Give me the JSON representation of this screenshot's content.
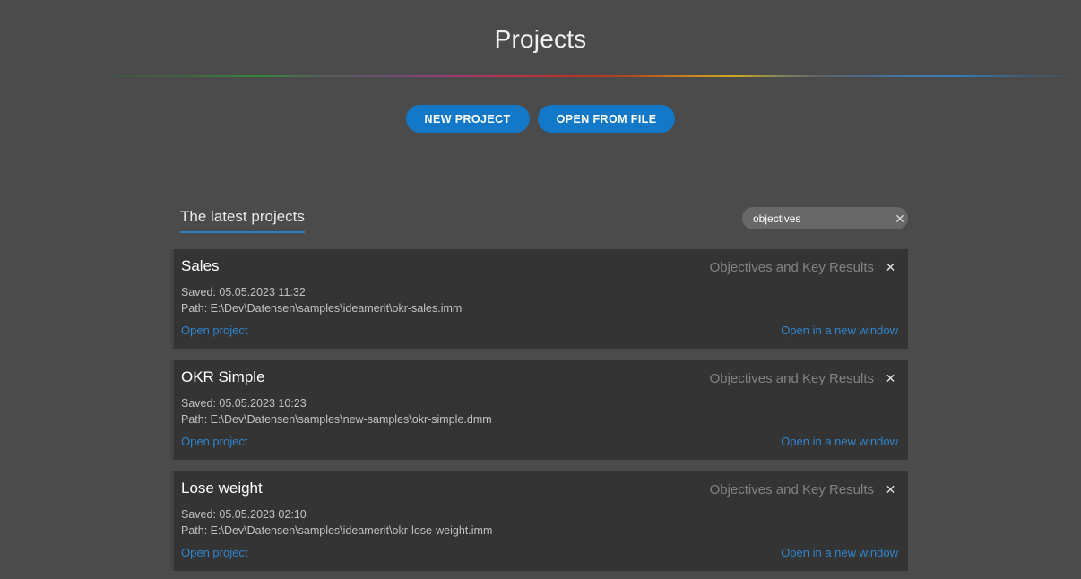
{
  "header": {
    "title": "Projects",
    "divider": "rainbow-gradient-divider"
  },
  "actions": {
    "new_project_label": "NEW PROJECT",
    "open_from_file_label": "OPEN FROM FILE",
    "button_color": "#1478c8"
  },
  "section": {
    "title": "The latest projects",
    "underline_color": "#2f7fc0"
  },
  "search": {
    "value": "objectives",
    "placeholder": "",
    "clear_icon": "close-icon",
    "clear_glyph": "✕"
  },
  "labels": {
    "open_project": "Open project",
    "open_in_new_window": "Open in a new window",
    "close_glyph": "✕",
    "saved_prefix": "Saved: ",
    "path_prefix": "Path: "
  },
  "projects": [
    {
      "name": "Sales",
      "type": "Objectives and Key Results",
      "saved": "Saved: 05.05.2023 11:32",
      "path": "Path: E:\\Dev\\Datensen\\samples\\ideamerit\\okr-sales.imm",
      "open_project": "Open project",
      "open_new_window": "Open in a new window"
    },
    {
      "name": "OKR Simple",
      "type": "Objectives and Key Results",
      "saved": "Saved: 05.05.2023 10:23",
      "path": "Path: E:\\Dev\\Datensen\\samples\\new-samples\\okr-simple.dmm",
      "open_project": "Open project",
      "open_new_window": "Open in a new window"
    },
    {
      "name": "Lose weight",
      "type": "Objectives and Key Results",
      "saved": "Saved: 05.05.2023 02:10",
      "path": "Path: E:\\Dev\\Datensen\\samples\\ideamerit\\okr-lose-weight.imm",
      "open_project": "Open project",
      "open_new_window": "Open in a new window"
    }
  ],
  "colors": {
    "page_background": "#4b4b4b",
    "card_background": "#343434",
    "accent_blue": "#2f85d0",
    "muted_text": "#828282"
  }
}
